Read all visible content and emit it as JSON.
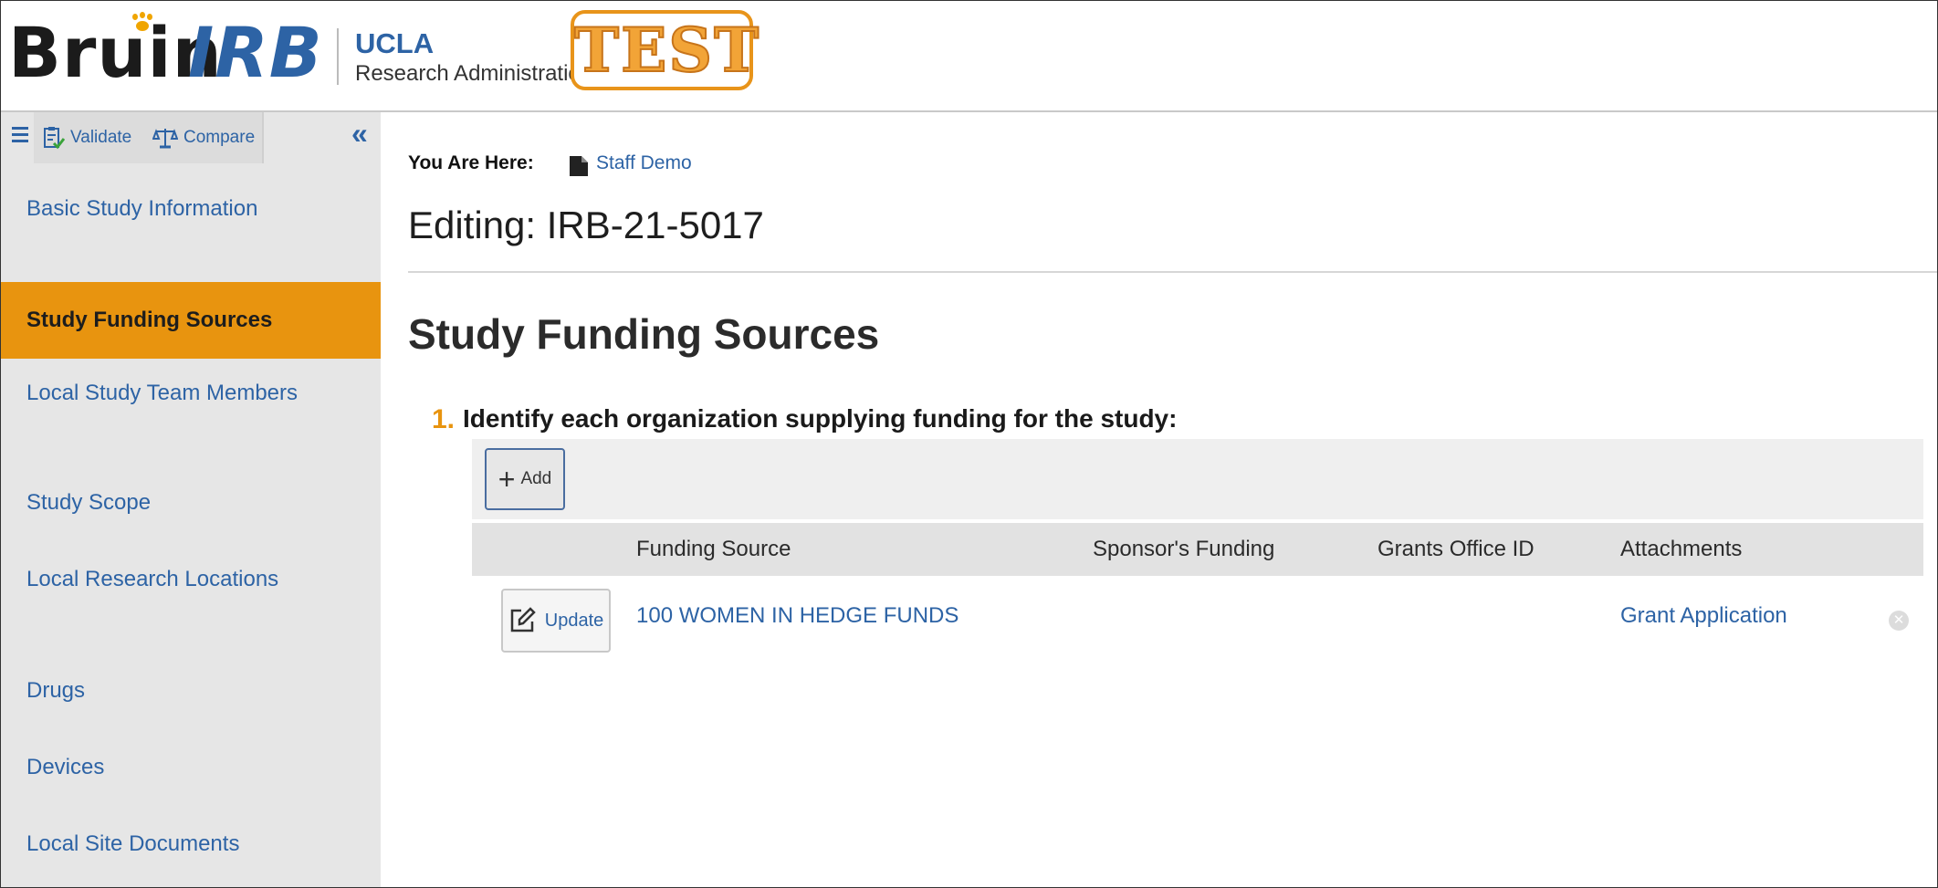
{
  "header": {
    "logo_left": "Bruin",
    "logo_right": "IRB",
    "org_name": "UCLA",
    "org_subtitle": "Research Administration",
    "env_badge": "TEST"
  },
  "sidebar": {
    "toolbar": {
      "validate_label": "Validate",
      "compare_label": "Compare"
    },
    "items": [
      {
        "label": "Basic Study Information"
      },
      {
        "label": "Study Funding Sources"
      },
      {
        "label": "Local Study Team Members"
      },
      {
        "label": "Study Scope"
      },
      {
        "label": "Local Research Locations"
      },
      {
        "label": "Drugs"
      },
      {
        "label": "Devices"
      },
      {
        "label": "Local Site Documents"
      }
    ]
  },
  "breadcrumb": {
    "label": "You Are Here:",
    "link": "Staff Demo"
  },
  "page": {
    "title": "Editing: IRB-21-5017",
    "section_title": "Study Funding Sources"
  },
  "question": {
    "number": "1.",
    "text": "Identify each organization supplying funding for the study:"
  },
  "table": {
    "add_label": "Add",
    "columns": [
      "Funding Source",
      "Sponsor's Funding",
      "Grants Office ID",
      "Attachments"
    ],
    "rows": [
      {
        "update_label": "Update",
        "funding_source": "100 WOMEN IN HEDGE FUNDS",
        "sponsors_funding": "",
        "grants_office_id": "",
        "attachments": "Grant Application"
      }
    ]
  },
  "colors": {
    "link_blue": "#2d63a5",
    "accent_orange": "#e8940f",
    "sidebar_bg": "#e6e6e6"
  }
}
